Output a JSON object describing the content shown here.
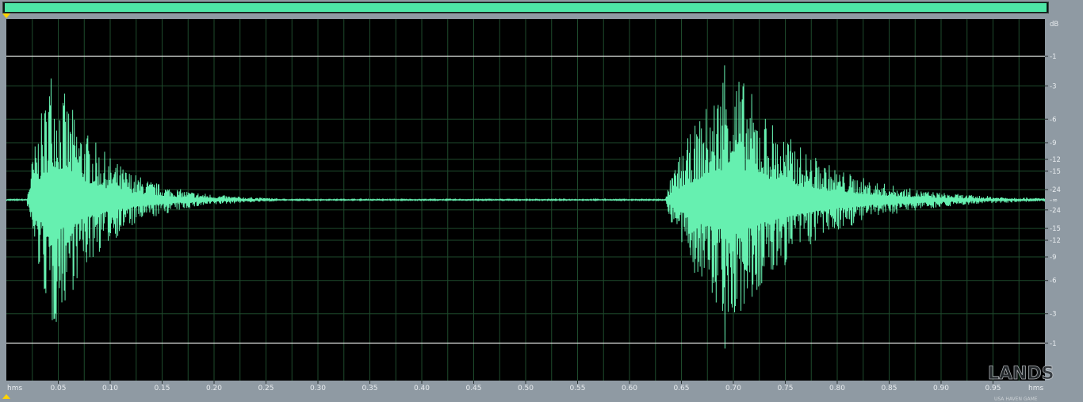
{
  "colors": {
    "waveform": "#66f0b0",
    "grid": "#1e4a2c",
    "panel_bg": "#000000",
    "chrome": "#8f9aa3",
    "overview_fill": "#4ee6a6",
    "marker": "#ffd400"
  },
  "db_ruler": {
    "unit": "dB",
    "upper_labels": [
      "-1",
      "-3",
      "-6",
      "-9",
      "-12",
      "-15",
      "-24"
    ],
    "center_label": "-∞",
    "lower_labels": [
      "-24",
      "-15",
      "-12",
      "-9",
      "-6",
      "-3",
      "-1"
    ]
  },
  "time_ruler": {
    "format_left": "hms",
    "format_right": "hms",
    "labels": [
      "0.05",
      "0.10",
      "0.15",
      "0.20",
      "0.25",
      "0.30",
      "0.35",
      "0.40",
      "0.45",
      "0.50",
      "0.55",
      "0.60",
      "0.65",
      "0.70",
      "0.75",
      "0.80",
      "0.85",
      "0.90",
      "0.95"
    ]
  },
  "watermark": {
    "text": "LANDS",
    "subtext": "USA HAVEN GAME"
  },
  "chart_data": {
    "type": "line",
    "xlabel": "hms",
    "ylabel": "dB",
    "xlim": [
      0.0,
      1.0
    ],
    "ylim": [
      -1,
      1
    ],
    "x_ticks": [
      0.05,
      0.1,
      0.15,
      0.2,
      0.25,
      0.3,
      0.35,
      0.4,
      0.45,
      0.5,
      0.55,
      0.6,
      0.65,
      0.7,
      0.75,
      0.8,
      0.85,
      0.9,
      0.95
    ],
    "y_levels_db": [
      -1,
      -3,
      -6,
      -9,
      -12,
      -15,
      -24
    ],
    "bursts": [
      {
        "start": 0.02,
        "peak": 0.04,
        "end": 0.26,
        "peak_amplitude": 0.93
      },
      {
        "start": 0.635,
        "peak": 0.69,
        "end": 1.0,
        "peak_amplitude": 1.0
      }
    ]
  }
}
